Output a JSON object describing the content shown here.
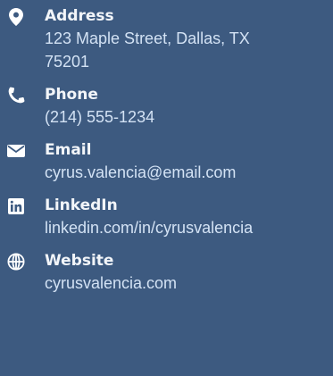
{
  "colors": {
    "background": "#3d5a80",
    "label": "#f2f5f9",
    "value": "#d3e2f4",
    "icon": "#ffffff"
  },
  "contacts": [
    {
      "icon": "map-pin-icon",
      "label": "Address",
      "value": "123 Maple Street, Dallas, TX\n75201"
    },
    {
      "icon": "phone-icon",
      "label": "Phone",
      "value": "(214) 555-1234"
    },
    {
      "icon": "envelope-icon",
      "label": "Email",
      "value": "cyrus.valencia@email.com"
    },
    {
      "icon": "linkedin-icon",
      "label": "LinkedIn",
      "value": "linkedin.com/in/cyrusvalencia"
    },
    {
      "icon": "globe-icon",
      "label": "Website",
      "value": "cyrusvalencia.com"
    }
  ]
}
